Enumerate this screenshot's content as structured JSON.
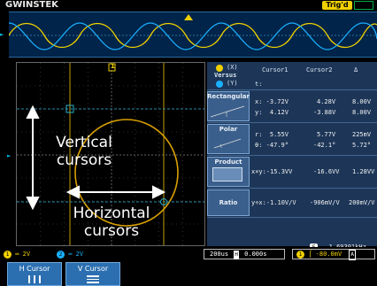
{
  "brand": "GWINSTEK",
  "trigger_status": "Trig'd",
  "ch1_marker": "1",
  "cursor_flag": "1",
  "overlay": {
    "vertical_label_line1": "Vertical",
    "vertical_label_line2": "cursors",
    "horizontal_label_line1": "Horizontal",
    "horizontal_label_line2": "cursors"
  },
  "panel": {
    "xy_header_line1": "(X)",
    "versus": "Versus",
    "xy_header_line2": "(Y)",
    "col1": "Cursor1",
    "col2": "Cursor2",
    "col3": "Δ",
    "t_label": "t:",
    "rows": [
      {
        "label": "Rectangular",
        "l1": "x: -3.72V",
        "l1c2": "4.28V",
        "l1c3": "8.00V",
        "l2": "y:  4.12V",
        "l2c2": "-3.88V",
        "l2c3": "8.00V"
      },
      {
        "label": "Polar",
        "l1": "r:  5.55V",
        "l1c2": "5.77V",
        "l1c3": "225mV",
        "l2": "θ: -47.9°",
        "l2c2": "-42.1°",
        "l2c3": "5.72°"
      },
      {
        "label": "Product",
        "l1": "x×y:-15.3VV",
        "l1c2": "-16.6VV",
        "l1c3": "1.28VV"
      },
      {
        "label": "Ratio",
        "l1": "y÷x:-1.10V/V",
        "l1c2": "-906mV/V",
        "l1c3": "200mV/V"
      }
    ]
  },
  "status": {
    "ch1_scale": "2V",
    "ch2_scale": "2V",
    "ch1_badge": "1",
    "ch2_badge": "2",
    "freq_badge": "F",
    "frequency": "1.69301kHz",
    "timebase": "200us",
    "h_pos_icon": "H",
    "h_position": "0.000s",
    "trig_badge": "1",
    "trig_level": "-80.0mV",
    "trig_coupling": "A"
  },
  "softkeys": [
    {
      "label": "H Cursor",
      "icon": "vertical-bars-icon"
    },
    {
      "label": "V Cursor",
      "icon": "horizontal-bars-icon"
    }
  ],
  "colors": {
    "ch1": "#f0d000",
    "ch2": "#1ab0ff",
    "panel_bg": "#1d3658",
    "overview_bg": "#00244a",
    "softkey_bg": "#2b6fb0"
  }
}
